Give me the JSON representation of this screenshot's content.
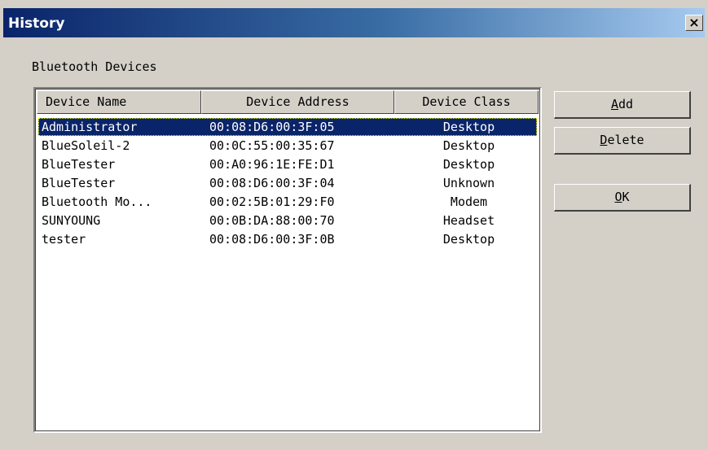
{
  "window": {
    "title": "History",
    "close_glyph": "×"
  },
  "group": {
    "label": "Bluetooth Devices"
  },
  "table": {
    "columns": [
      "Device Name",
      "Device Address",
      "Device Class"
    ],
    "rows": [
      {
        "name": "Administrator",
        "address": "00:08:D6:00:3F:05",
        "class": "Desktop",
        "selected": true
      },
      {
        "name": "BlueSoleil-2",
        "address": "00:0C:55:00:35:67",
        "class": "Desktop"
      },
      {
        "name": "BlueTester",
        "address": "00:A0:96:1E:FE:D1",
        "class": "Desktop"
      },
      {
        "name": "BlueTester",
        "address": "00:08:D6:00:3F:04",
        "class": "Unknown"
      },
      {
        "name": "Bluetooth Mo...",
        "address": "00:02:5B:01:29:F0",
        "class": "Modem"
      },
      {
        "name": "SUNYOUNG",
        "address": "00:0B:DA:88:00:70",
        "class": "Headset"
      },
      {
        "name": "tester",
        "address": "00:08:D6:00:3F:0B",
        "class": "Desktop"
      }
    ]
  },
  "buttons": {
    "add": {
      "mnemonic": "A",
      "rest": "dd"
    },
    "delete": {
      "mnemonic": "D",
      "rest": "elete"
    },
    "ok": {
      "mnemonic": "O",
      "rest": "K"
    }
  },
  "colors": {
    "selection": "#0a246a",
    "face": "#d4d0c8",
    "title_start": "#0a246a",
    "title_end": "#a6caf0"
  }
}
